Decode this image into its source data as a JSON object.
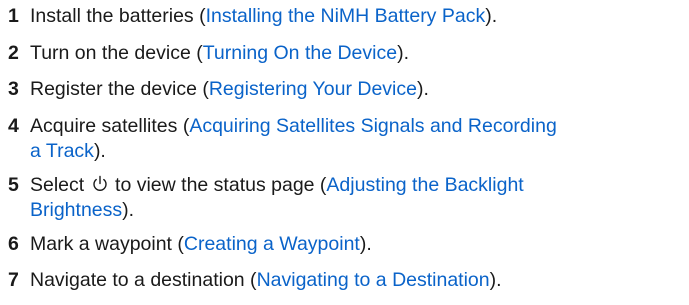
{
  "steps": [
    {
      "number": "1",
      "text_before": "Install the batteries (",
      "link": "Installing the NiMH Battery Pack",
      "text_after": ")."
    },
    {
      "number": "2",
      "text_before": "Turn on the device (",
      "link": "Turning On the Device",
      "text_after": ")."
    },
    {
      "number": "3",
      "text_before": "Register the device (",
      "link": "Registering Your Device",
      "text_after": ")."
    },
    {
      "number": "4",
      "text_before": "Acquire satellites (",
      "link_line1": "Acquiring Satellites Signals and Recording",
      "link_line2": "a Track",
      "text_after": ")."
    },
    {
      "number": "5",
      "text_before": "Select",
      "icon": "power-icon",
      "text_middle": "to view the status page (",
      "link_line1": "Adjusting the Backlight",
      "link_line2": "Brightness",
      "text_after": ")."
    },
    {
      "number": "6",
      "text_before": "Mark a waypoint (",
      "link": "Creating a Waypoint",
      "text_after": ")."
    },
    {
      "number": "7",
      "text_before": "Navigate to a destination (",
      "link": "Navigating to a Destination",
      "text_after": ")."
    }
  ],
  "colors": {
    "text": "#1a1a1a",
    "link": "#0a63c9"
  }
}
